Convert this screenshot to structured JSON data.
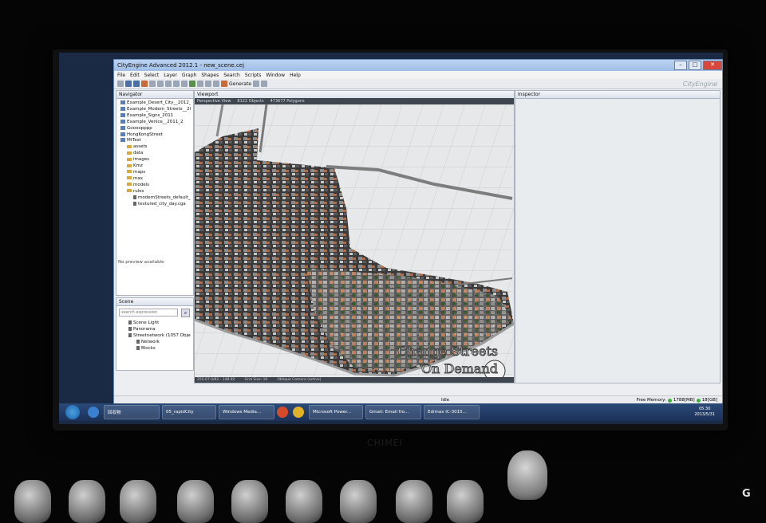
{
  "window": {
    "title": "CityEngine Advanced 2012.1 - new_scene.cej",
    "brand": "CityEngine",
    "controls": {
      "minimize": "–",
      "maximize": "□",
      "close": "✕"
    }
  },
  "menu": [
    "File",
    "Edit",
    "Select",
    "Layer",
    "Graph",
    "Shapes",
    "Search",
    "Scripts",
    "Window",
    "Help"
  ],
  "toolbar": {
    "generate_label": "Generate"
  },
  "navigator": {
    "tab": "Navigator",
    "items": [
      {
        "label": "Example_Desert_City__2012_1",
        "type": "proj"
      },
      {
        "label": "Example_Modern_Streets__2011_",
        "type": "proj"
      },
      {
        "label": "Example_Signs_2011",
        "type": "proj"
      },
      {
        "label": "Example_Venice__2011_2",
        "type": "proj"
      },
      {
        "label": "Goooopppp",
        "type": "proj"
      },
      {
        "label": "HongKongStreet",
        "type": "proj"
      },
      {
        "label": "MtTest",
        "type": "proj"
      },
      {
        "label": "assets",
        "type": "fold"
      },
      {
        "label": "data",
        "type": "fold"
      },
      {
        "label": "images",
        "type": "fold"
      },
      {
        "label": "Kmz",
        "type": "fold"
      },
      {
        "label": "maps",
        "type": "fold"
      },
      {
        "label": "max",
        "type": "fold"
      },
      {
        "label": "models",
        "type": "fold"
      },
      {
        "label": "rules",
        "type": "fold"
      },
      {
        "label": "modernStreets_default_",
        "type": "file"
      },
      {
        "label": "textured_city_day.cga",
        "type": "file"
      }
    ],
    "preview": "No preview available"
  },
  "scene": {
    "tab": "Scene",
    "search_placeholder": "search expression",
    "items": [
      "Scene Light",
      "Panorama",
      "Streetnetwork (1057 Object",
      "Network",
      "Blocks"
    ]
  },
  "viewport": {
    "tab": "Viewport",
    "info": [
      "Perspective View",
      "8122 Objects",
      "473677 Polygons"
    ],
    "status": [
      "255.67.0/82 - 148.92",
      "Grid Size: 10",
      "Oblique Camera (active)"
    ],
    "overlay_line1": "Change Streets",
    "overlay_line2": "On Demand"
  },
  "inspector": {
    "tab": "Inspector"
  },
  "statusbar": {
    "idle": "Idle",
    "free_memory_label": "Free Memory:",
    "mem1": "1788[MB]",
    "mem2": "18[GB]"
  },
  "taskbar": {
    "items": [
      "回収物",
      "05_rapidCity",
      "Windows Media...",
      "Microsoft Power...",
      "Gmail: Email fro...",
      "Edimax IC-3015..."
    ],
    "time": "05:30",
    "date": "2013/5/31"
  },
  "monitor_brand": "CHIMEI"
}
